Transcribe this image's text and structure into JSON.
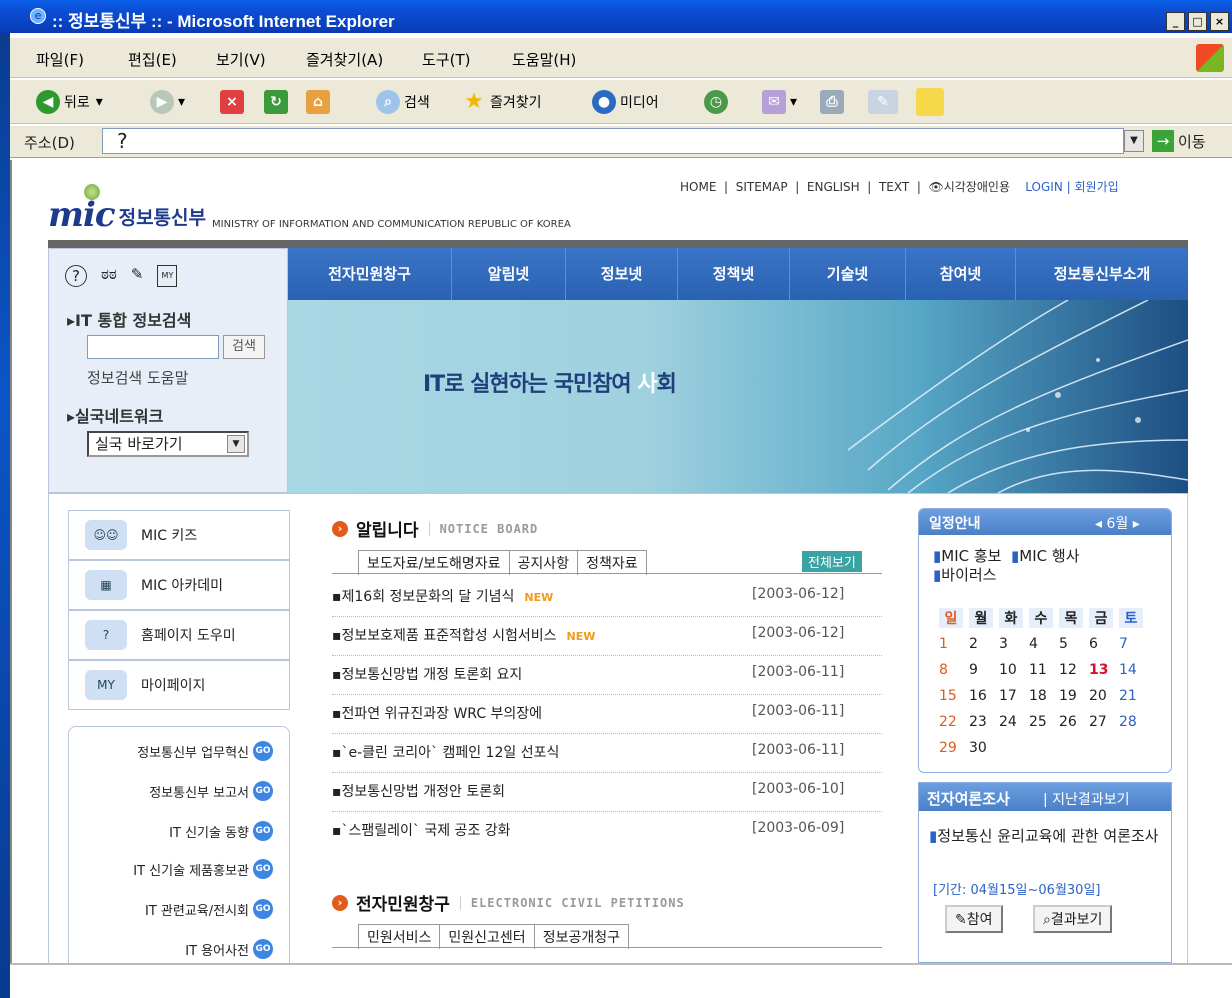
{
  "window": {
    "title": ":: 정보통신부 :: - Microsoft Internet Explorer",
    "btn_min": "_",
    "btn_max": "□",
    "btn_close": "×"
  },
  "menubar": [
    "파일(F)",
    "편집(E)",
    "보기(V)",
    "즐겨찾기(A)",
    "도구(T)",
    "도움말(H)"
  ],
  "toolbar": {
    "back": "뒤로",
    "search": "검색",
    "favorites": "즐겨찾기",
    "media": "미디어"
  },
  "address": {
    "label": "주소(D)",
    "value": "?",
    "go": "이동"
  },
  "site": {
    "topnav": [
      "HOME",
      "SITEMAP",
      "ENGLISH",
      "TEXT",
      "👁시각장애인용",
      "LOGIN",
      "회원가입"
    ],
    "logo_mark": "mic",
    "logo_kr": "정보통신부",
    "logo_en": "MINISTRY OF INFORMATION AND COMMUNICATION REPUBLIC OF KOREA",
    "nav": [
      "전자민원창구",
      "알림넷",
      "정보넷",
      "정책넷",
      "기술넷",
      "참여넷",
      "정보통신부소개"
    ],
    "banner_text_a": "IT로 실현하는 국민참여 ",
    "banner_text_b": "사",
    "banner_text_c": "회",
    "search_title": "IT 통합 정보검색",
    "search_button": "검색",
    "search_help": "정보검색 도움말",
    "network_title": "실국네트워크",
    "network_select": "실국 바로가기",
    "side_buttons": [
      "MIC 키즈",
      "MIC 아카데미",
      "홈페이지 도우미",
      "마이페이지"
    ],
    "go_label": "GO",
    "go_items": [
      "정보통신부 업무혁신",
      "정보통신부 보고서",
      "IT 신기술 동향",
      "IT 신기술 제품홍보관",
      "IT 관련교육/전시회",
      "IT 용어사전"
    ],
    "notice": {
      "title": "알립니다",
      "title_en": "NOTICE BOARD",
      "tabs": [
        "보도자료/보도해명자료",
        "공지사항",
        "정책자료"
      ],
      "view_all": "전체보기",
      "new_label": "NEW",
      "items": [
        {
          "title": "제16회 정보문화의 달 기념식",
          "date": "[2003-06-12]",
          "new": true
        },
        {
          "title": "정보보호제품 표준적합성 시험서비스",
          "date": "[2003-06-12]",
          "new": true
        },
        {
          "title": "정보통신망법 개정 토론회 요지",
          "date": "[2003-06-11]",
          "new": false
        },
        {
          "title": "전파연 위규진과장 WRC 부의장에",
          "date": "[2003-06-11]",
          "new": false
        },
        {
          "title": "`e-클린 코리아` 캠페인 12일 선포식",
          "date": "[2003-06-11]",
          "new": false
        },
        {
          "title": "정보통신망법 개정안 토론회",
          "date": "[2003-06-10]",
          "new": false
        },
        {
          "title": "`스팸릴레이` 국제 공조 강화",
          "date": "[2003-06-09]",
          "new": false
        }
      ]
    },
    "petition": {
      "title": "전자민원창구",
      "title_en": "ELECTRONIC CIVIL PETITIONS",
      "tabs": [
        "민원서비스",
        "민원신고센터",
        "정보공개청구"
      ]
    },
    "calendar": {
      "title": "일정안내",
      "month": "6월",
      "legend": [
        "MIC 홍보",
        "MIC 행사",
        "바이러스"
      ],
      "weekdays": [
        "일",
        "월",
        "화",
        "수",
        "목",
        "금",
        "토"
      ],
      "weeks": [
        [
          "1",
          "2",
          "3",
          "4",
          "5",
          "6",
          "7"
        ],
        [
          "8",
          "9",
          "10",
          "11",
          "12",
          "13",
          "14"
        ],
        [
          "15",
          "16",
          "17",
          "18",
          "19",
          "20",
          "21"
        ],
        [
          "22",
          "23",
          "24",
          "25",
          "26",
          "27",
          "28"
        ],
        [
          "29",
          "30",
          "",
          "",
          "",
          "",
          ""
        ]
      ],
      "today": "13",
      "colors": {
        "sunday": "#e25a1c",
        "saturday": "#2a62c8",
        "today": "#d8102a"
      }
    },
    "poll": {
      "title": "전자여론조사",
      "past": "지난결과보기",
      "question": "정보통신 윤리교육에 관한 여론조사",
      "period": "[기간: 04월15일~06월30일]",
      "join": "참여",
      "result": "결과보기"
    }
  }
}
